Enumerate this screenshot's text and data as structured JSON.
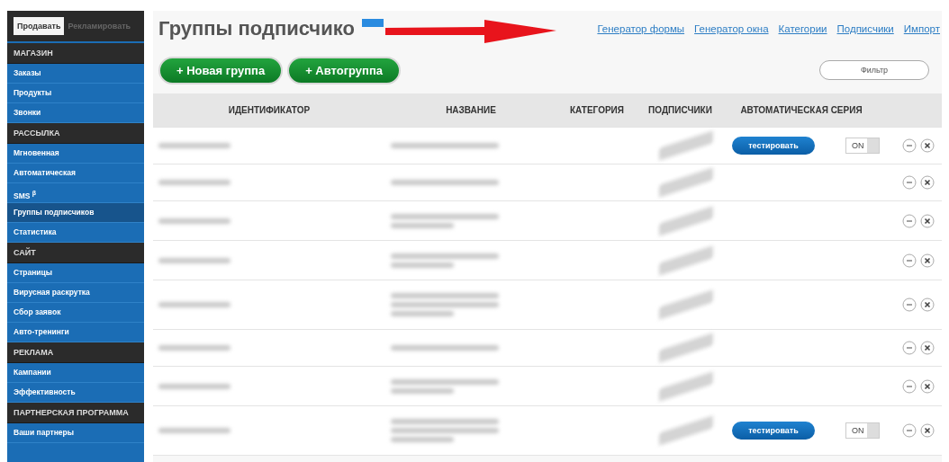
{
  "sidebar": {
    "tabs": [
      {
        "label": "Продавать",
        "selected": true
      },
      {
        "label": "Рекламировать",
        "selected": false
      }
    ],
    "sections": [
      {
        "title": "МАГАЗИН",
        "items": [
          {
            "label": "Заказы",
            "selected": false
          },
          {
            "label": "Продукты",
            "selected": false
          },
          {
            "label": "Звонки",
            "selected": false
          }
        ]
      },
      {
        "title": "РАССЫЛКА",
        "items": [
          {
            "label": "Мгновенная",
            "selected": false
          },
          {
            "label": "Автоматическая",
            "selected": false
          },
          {
            "label": "SMS $^{β}$",
            "selected": false
          },
          {
            "label": "Группы подписчиков",
            "selected": true
          },
          {
            "label": "Статистика",
            "selected": false
          }
        ]
      },
      {
        "title": "САЙТ",
        "items": [
          {
            "label": "Страницы",
            "selected": false
          },
          {
            "label": "Вирусная раскрутка",
            "selected": false
          },
          {
            "label": "Сбор заявок",
            "selected": false
          },
          {
            "label": "Авто-тренинги",
            "selected": false
          }
        ]
      },
      {
        "title": "РЕКЛАМА",
        "items": [
          {
            "label": "Кампании",
            "selected": false
          },
          {
            "label": "Эффективность",
            "selected": false
          }
        ]
      },
      {
        "title": "ПАРТНЕРСКАЯ ПРОГРАММА",
        "items": [
          {
            "label": "Ваши партнеры",
            "selected": false
          }
        ]
      }
    ]
  },
  "page": {
    "title": "Группы подписчико",
    "links": [
      "Генератор формы",
      "Генератор окна",
      "Категории",
      "Подписчики",
      "Импорт"
    ],
    "buttons": [
      "+ Новая группа",
      "+ Автогруппа"
    ],
    "filter_button": "Фильтр"
  },
  "table": {
    "columns": [
      "ИДЕНТИФИКАТОР",
      "НАЗВАНИЕ",
      "КАТЕГОРИЯ",
      "ПОДПИСЧИКИ",
      "АВТОМАТИЧЕСКАЯ СЕРИЯ"
    ],
    "rows": [
      {
        "kind": "single",
        "auto_series": {
          "button": "тестировать",
          "toggle": "ON"
        }
      },
      {
        "kind": "single"
      },
      {
        "kind": "double"
      },
      {
        "kind": "double"
      },
      {
        "kind": "triple"
      },
      {
        "kind": "single"
      },
      {
        "kind": "double"
      },
      {
        "kind": "triple",
        "auto_series": {
          "button": "тестировать",
          "toggle": "ON"
        }
      }
    ]
  }
}
